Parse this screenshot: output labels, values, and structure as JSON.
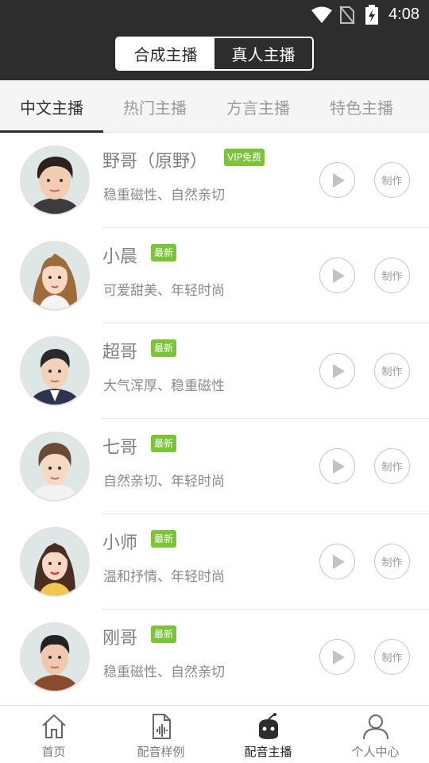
{
  "status_bar": {
    "time": "4:08"
  },
  "segment": {
    "options": [
      "合成主播",
      "真人主播"
    ],
    "selected": 0
  },
  "tabs": [
    {
      "label": "中文主播",
      "active": true
    },
    {
      "label": "热门主播",
      "active": false
    },
    {
      "label": "方言主播",
      "active": false
    },
    {
      "label": "特色主播",
      "active": false
    }
  ],
  "anchors": [
    {
      "name": "野哥（原野）",
      "badge": "VIP免费",
      "desc": "稳重磁性、自然亲切",
      "make_label": "制作"
    },
    {
      "name": "小晨",
      "badge": "最新",
      "desc": "可爱甜美、年轻时尚",
      "make_label": "制作"
    },
    {
      "name": "超哥",
      "badge": "最新",
      "desc": "大气浑厚、稳重磁性",
      "make_label": "制作"
    },
    {
      "name": "七哥",
      "badge": "最新",
      "desc": "自然亲切、年轻时尚",
      "make_label": "制作"
    },
    {
      "name": "小师",
      "badge": "最新",
      "desc": "温和抒情、年轻时尚",
      "make_label": "制作"
    },
    {
      "name": "刚哥",
      "badge": "最新",
      "desc": "稳重磁性、自然亲切",
      "make_label": "制作"
    }
  ],
  "bottom_nav": [
    {
      "label": "首页",
      "icon": "home-icon",
      "active": false
    },
    {
      "label": "配音样例",
      "icon": "audio-file-icon",
      "active": false
    },
    {
      "label": "配音主播",
      "icon": "robot-icon",
      "active": true
    },
    {
      "label": "个人中心",
      "icon": "person-icon",
      "active": false
    }
  ],
  "colors": {
    "header": "#2d2d2d",
    "badge": "#7cc33c"
  }
}
